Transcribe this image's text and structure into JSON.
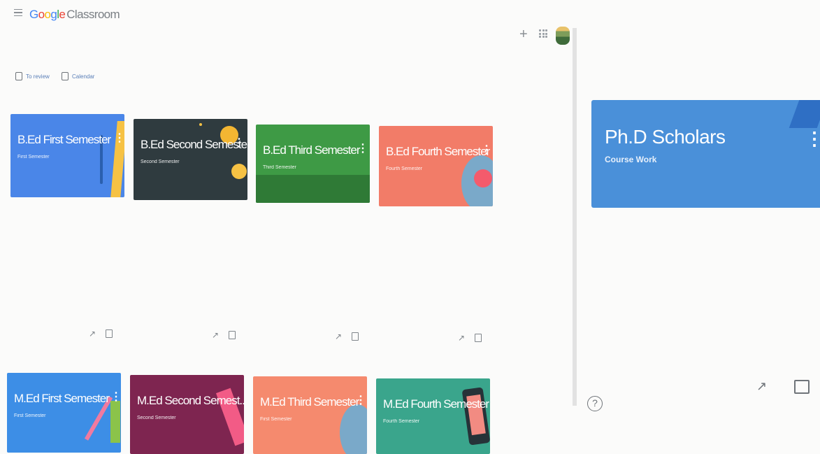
{
  "header": {
    "logo_google": [
      "G",
      "o",
      "o",
      "g",
      "l",
      "e"
    ],
    "logo_product": "Classroom",
    "menu_icon": "hamburger-menu-icon",
    "create_icon": "plus-icon",
    "apps_icon": "apps-grid-icon"
  },
  "subnav": {
    "todo_label": "To review",
    "calendar_label": "Calendar"
  },
  "classes_row1": [
    {
      "title": "B.Ed First Semester",
      "section": "First Semester",
      "color": "#4a86e8"
    },
    {
      "title": "B.Ed Second Semester",
      "section": "Second Semester",
      "color": "#2f3b3f"
    },
    {
      "title": "B.Ed Third Semester",
      "section": "Third Semester",
      "color": "#3e9a45"
    },
    {
      "title": "B.Ed Fourth Semester",
      "section": "Fourth Semester",
      "color": "#f27c68"
    }
  ],
  "classes_row2": [
    {
      "title": "M.Ed First Semester",
      "section": "First Semester",
      "color": "#3d8ee6"
    },
    {
      "title": "M.Ed Second Semest...",
      "section": "Second Semester",
      "color": "#7e2550"
    },
    {
      "title": "M.Ed Third Semester",
      "section": "First Semester",
      "color": "#f58a6e"
    },
    {
      "title": "M.Ed Fourth Semester",
      "section": "Fourth Semester",
      "color": "#3aa58c"
    }
  ],
  "featured_class": {
    "title": "Ph.D Scholars",
    "section": "Course Work",
    "color": "#4a90d9"
  },
  "help_label": "?"
}
